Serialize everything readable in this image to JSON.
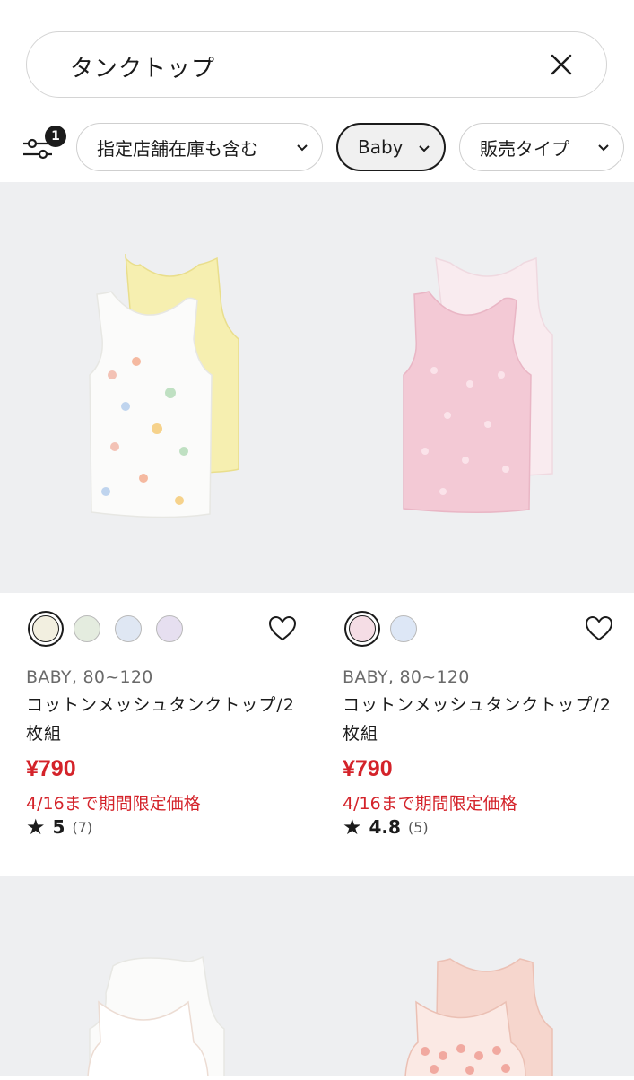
{
  "search": {
    "query": "タンクトップ"
  },
  "filters": {
    "badge_count": "1",
    "chips": [
      {
        "label": "指定店舗在庫も含む"
      },
      {
        "label": "Baby"
      },
      {
        "label": "販売タイプ"
      }
    ]
  },
  "products": [
    {
      "category": "BABY, 80~120",
      "name": "コットンメッシュタンクトップ/2枚組",
      "price": "¥790",
      "promo": "4/16まで期間限定価格",
      "rating": "5",
      "review_count": "(7)",
      "swatches": [
        "#f2efe0",
        "#e4ecdf",
        "#dfe7f3",
        "#e6dff0"
      ]
    },
    {
      "category": "BABY, 80~120",
      "name": "コットンメッシュタンクトップ/2枚組",
      "price": "¥790",
      "promo": "4/16まで期間限定価格",
      "rating": "4.8",
      "review_count": "(5)",
      "swatches": [
        "#f5dde5",
        "#dde7f6"
      ]
    }
  ],
  "colors": {
    "accent_red": "#d4232a",
    "image_bg": "#eeeff1"
  }
}
